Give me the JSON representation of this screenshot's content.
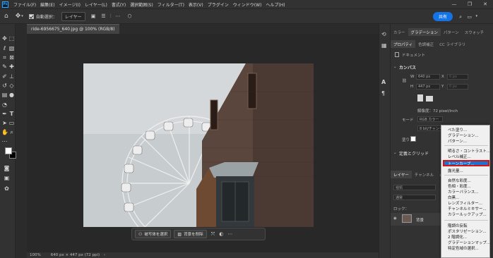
{
  "menubar": {
    "logo": "Ps",
    "items": [
      "ファイル(F)",
      "編集(E)",
      "イメージ(I)",
      "レイヤー(L)",
      "書式(Y)",
      "選択範囲(S)",
      "フィルター(T)",
      "表示(V)",
      "プラグイン",
      "ウィンドウ(W)",
      "ヘルプ(H)"
    ],
    "window_controls": [
      "—",
      "❐",
      "✕"
    ]
  },
  "options": {
    "auto_select_label": "自動選択：",
    "auto_select_value": "レイヤー",
    "share_label": "共有"
  },
  "document": {
    "tab_title": "ride-6956675_640.jpg @ 100% (RGB/8)",
    "zoom": "100%",
    "info": "640 px × 447 px (72 ppi)"
  },
  "context_bar": {
    "select_subject": "被写体を選択",
    "remove_bg": "背景を削除"
  },
  "panels": {
    "top_tabs": [
      "カラー",
      "グラデーション",
      "パターン",
      "スウォッチ"
    ],
    "props_tabs": [
      "プロパティ",
      "色調補正",
      "CC ライブラリ"
    ],
    "doc_label": "ドキュメント",
    "canvas_header": "カンバス",
    "w_label": "W",
    "w_value": "640 px",
    "h_label": "H",
    "h_value": "447 px",
    "x_label": "X",
    "x_value": "0 px",
    "y_label": "Y",
    "y_value": "0 px",
    "resolution": "解像度：72 pixel/inch",
    "mode_label": "モード",
    "mode_value": "RGB カラー",
    "bit_value": "8 bit/チャンネル",
    "fill_label": "塗り",
    "quick_actions": "定義とクリッド",
    "layers_tabs": [
      "レイヤー",
      "チャンネル",
      "パス"
    ],
    "search_placeholder": "種類",
    "blend_mode": "通常",
    "lock_label": "ロック：",
    "layer_name": "背景"
  },
  "dropdown": {
    "items": [
      "べた塗り...",
      "グラデーション...",
      "パターン...",
      "明るさ・コントラスト...",
      "レベル補正...",
      "トーンカーブ...",
      "露光量...",
      "自然な彩度...",
      "色相・彩度...",
      "カラーバランス...",
      "白黒...",
      "レンズフィルター...",
      "チャンネルミキサー...",
      "カラールックアップ...",
      "階調の反転",
      "ポスタリゼーション...",
      "2 階調化...",
      "グラデーションマップ...",
      "特定色域の選択..."
    ],
    "highlighted_index": 5
  },
  "colors": {
    "accent": "#1473e6",
    "highlight_border": "#d61414",
    "panel_bg": "#323232",
    "canvas_bg": "#282828"
  }
}
